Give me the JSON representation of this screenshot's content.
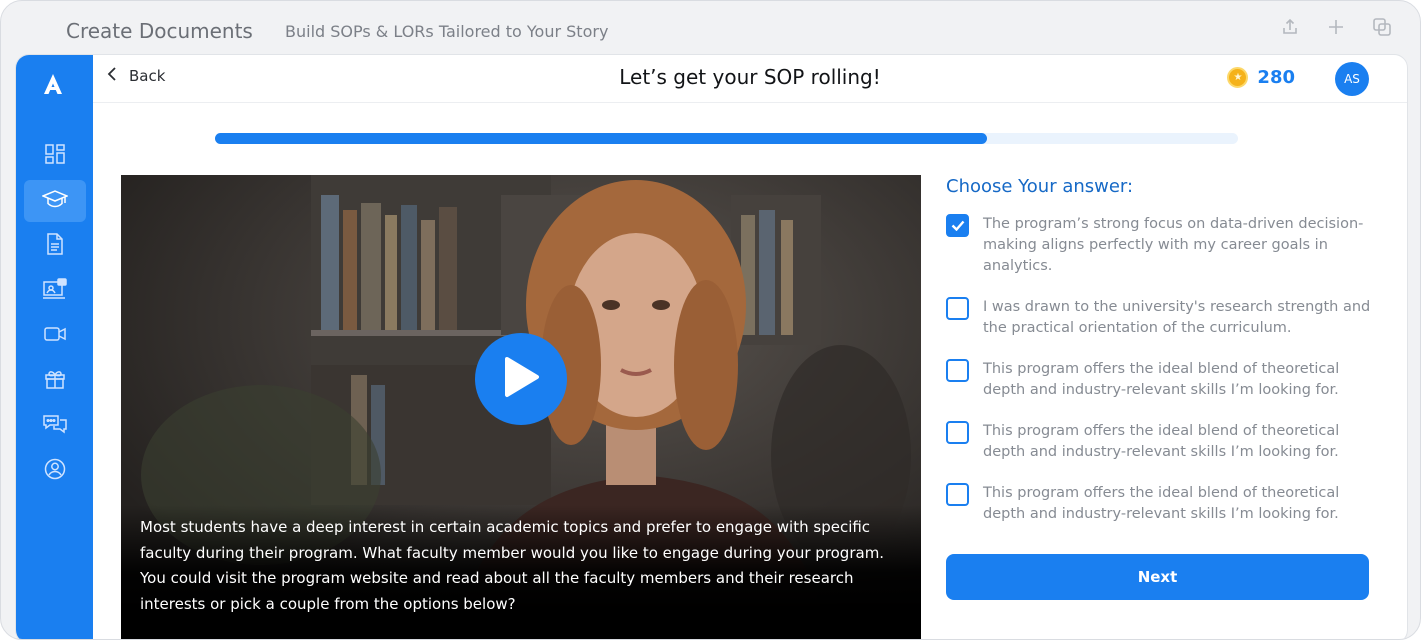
{
  "window": {
    "title": "Create Documents",
    "subtitle": "Build SOPs & LORs Tailored to Your Story",
    "icons": [
      "share-icon",
      "plus-icon",
      "duplicate-icon"
    ]
  },
  "sidebar": {
    "logo_icon": "logo-a-icon",
    "items": [
      {
        "icon": "dashboard-icon",
        "active": false
      },
      {
        "icon": "graduation-cap-icon",
        "active": true
      },
      {
        "icon": "document-icon",
        "active": false
      },
      {
        "icon": "presentation-icon",
        "active": false
      },
      {
        "icon": "video-camera-icon",
        "active": false
      },
      {
        "icon": "gift-icon",
        "active": false
      },
      {
        "icon": "chat-icon",
        "active": false
      },
      {
        "icon": "user-profile-icon",
        "active": false
      }
    ]
  },
  "header": {
    "back_label": "Back",
    "title": "Let’s get your SOP rolling!",
    "coins": "280",
    "avatar_initials": "AS"
  },
  "progress": {
    "fraction": 0.755
  },
  "video": {
    "caption": "Most students have a deep interest in certain academic topics and prefer to engage with specific faculty during their program. What faculty member would you like to engage during your program. You could visit the program website and read about all the faculty members and their research interests or pick a couple from the options below?"
  },
  "answers": {
    "title": "Choose Your answer:",
    "options": [
      {
        "text": "The program’s strong focus on data-driven decision-making aligns perfectly with my career goals in analytics.",
        "checked": true
      },
      {
        "text": "I was drawn to the university's research strength and the practical orientation of the curriculum.",
        "checked": false
      },
      {
        "text": "This program offers the ideal blend of theoretical depth and industry-relevant skills I’m looking for.",
        "checked": false
      },
      {
        "text": "This program offers the ideal blend of theoretical depth and industry-relevant skills I’m looking for.",
        "checked": false
      },
      {
        "text": "This program offers the ideal blend of theoretical depth and industry-relevant skills I’m looking for.",
        "checked": false
      }
    ],
    "next_label": "Next"
  },
  "colors": {
    "accent": "#1a7ff0",
    "title_blue": "#1669c6",
    "coin": "#f5b21a"
  }
}
